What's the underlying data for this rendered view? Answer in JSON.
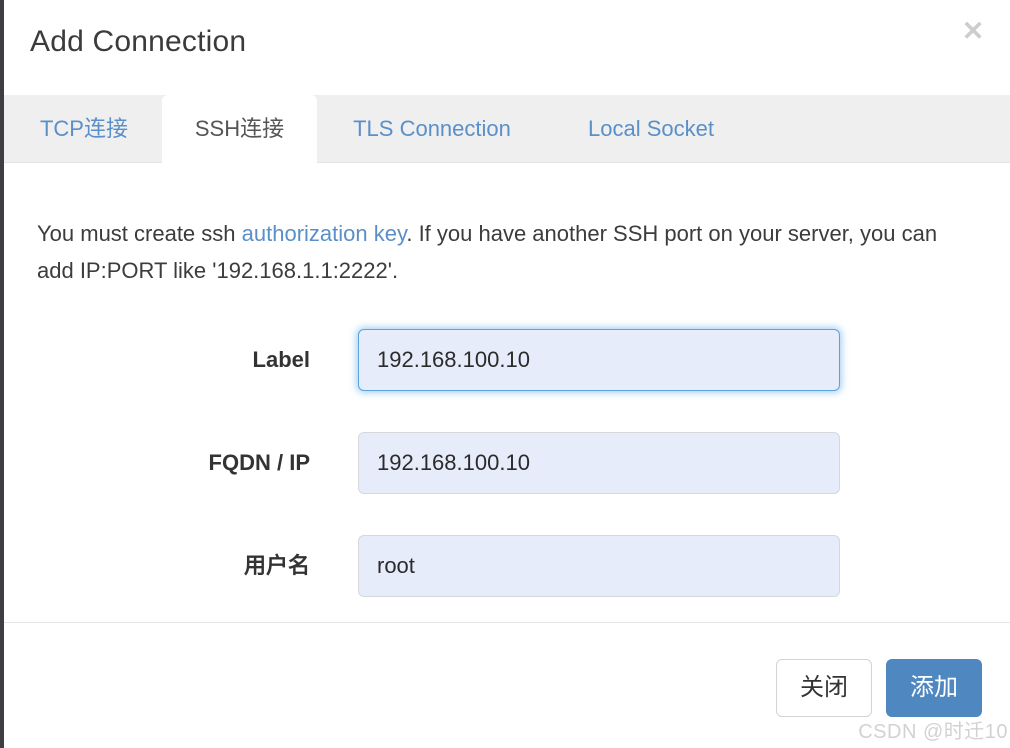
{
  "dialog": {
    "title": "Add Connection",
    "close_icon": "close-x-icon",
    "close_icon_glyph": "✕"
  },
  "tabs": [
    {
      "id": "tcp",
      "label": "TCP连接",
      "active": false
    },
    {
      "id": "ssh",
      "label": "SSH连接",
      "active": true
    },
    {
      "id": "tls",
      "label": "TLS Connection",
      "active": false
    },
    {
      "id": "local",
      "label": "Local Socket",
      "active": false
    }
  ],
  "body": {
    "help_text_before": "You must create ssh ",
    "help_link": "authorization key",
    "help_text_after": ". If you have another SSH port on your server, you can add IP:PORT like '192.168.1.1:2222'.",
    "fields": [
      {
        "id": "label",
        "label": "Label",
        "value": "192.168.100.10",
        "placeholder": "",
        "focused": true
      },
      {
        "id": "fqdn",
        "label": "FQDN / IP",
        "value": "192.168.100.10",
        "placeholder": "",
        "focused": false
      },
      {
        "id": "username",
        "label": "用户名",
        "value": "root",
        "placeholder": "",
        "focused": false
      }
    ]
  },
  "footer": {
    "close_label": "关闭",
    "add_label": "添加"
  },
  "watermark": "CSDN @时迁10",
  "colors": {
    "link": "#5b8fc9",
    "tab_text": "#5b8fc9",
    "tab_strip_bg": "#efefef",
    "input_bg": "#e6ecf9",
    "focus_border": "#5ba3e0",
    "primary_button": "#4f87c0",
    "title_text": "#3b3b3b",
    "watermark": "#d2d2d2"
  }
}
